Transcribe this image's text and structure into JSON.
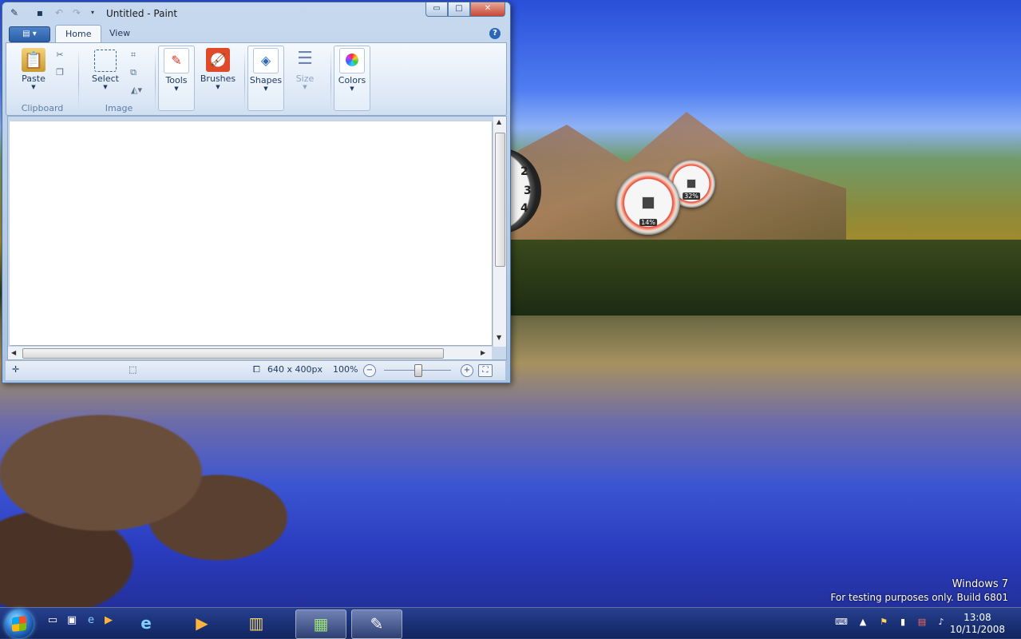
{
  "window": {
    "title": "Untitled - Paint",
    "caption": {
      "minimize": "▭",
      "maximize": "□",
      "close": "✕"
    }
  },
  "tabs": [
    {
      "label": "Home",
      "active": true
    },
    {
      "label": "View",
      "active": false
    }
  ],
  "ribbon": {
    "clipboard": {
      "paste": "Paste",
      "group_label": "Clipboard"
    },
    "image": {
      "select": "Select",
      "group_label": "Image"
    },
    "tools": "Tools",
    "brushes": "Brushes",
    "shapes": "Shapes",
    "size": "Size",
    "colors": "Colors"
  },
  "status": {
    "canvas_size": "640 x 400px",
    "zoom": "100%"
  },
  "gadgets": {
    "cpu": "14%",
    "memory": "32%",
    "clock_numbers": [
      "2",
      "3",
      "4"
    ]
  },
  "watermark": {
    "line1": "Windows  7",
    "line2": "For testing purposes only. Build 6801"
  },
  "taskbar": {
    "time": "13:08",
    "date": "10/11/2008"
  },
  "colors": {
    "accent": "#2b67b8",
    "close": "#c74632",
    "border": "#e0202a"
  }
}
